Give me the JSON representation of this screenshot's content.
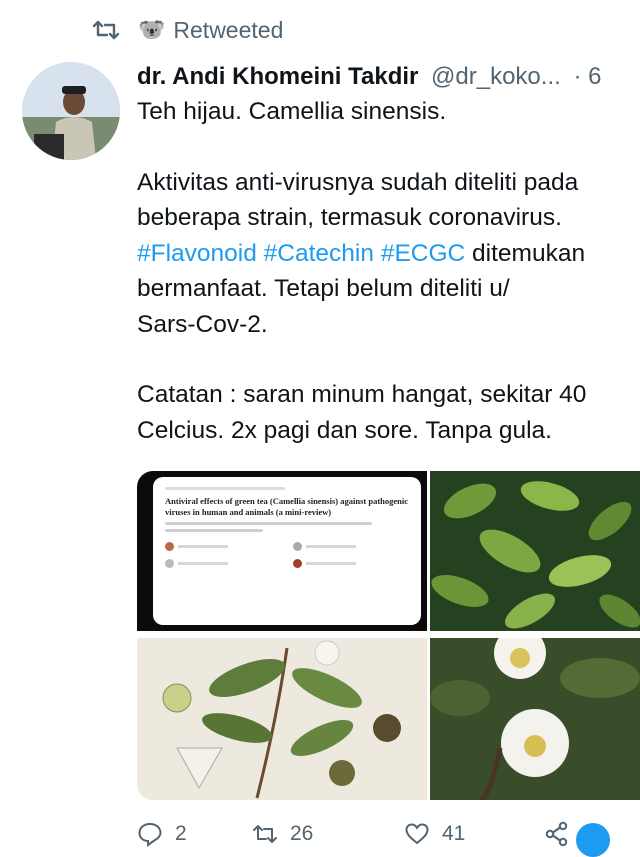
{
  "retweet": {
    "label": "Retweeted",
    "icon": "retweet-icon",
    "emoji": "🐨"
  },
  "author": {
    "name": "dr. Andi Khomeini Takdir",
    "handle": "@dr_koko...",
    "meta": "· 6"
  },
  "tweet": {
    "line1": "Teh hijau. Camellia sinensis.",
    "line2": "Aktivitas anti-virusnya sudah diteliti pada",
    "line3": "beberapa strain, termasuk coronavirus.",
    "hashtags": [
      "#Flavonoid",
      "#Catechin",
      "#ECGC"
    ],
    "line4_tail": "ditemukan",
    "line5": "bermanfaat. Tetapi belum diteliti u/",
    "line6": "Sars-Cov-2.",
    "line7": "Catatan : saran minum hangat, sekitar 40",
    "line8": "Celcius. 2x pagi dan sore. Tanpa gula."
  },
  "media": {
    "paper_title": "Antiviral effects of green tea (Camellia sinensis) against pathogenic viruses in human and animals (a mini-review)"
  },
  "actions": {
    "reply": "2",
    "retweet": "26",
    "like": "41"
  },
  "colors": {
    "accent": "#1d9bf0",
    "secondary": "#536471"
  }
}
